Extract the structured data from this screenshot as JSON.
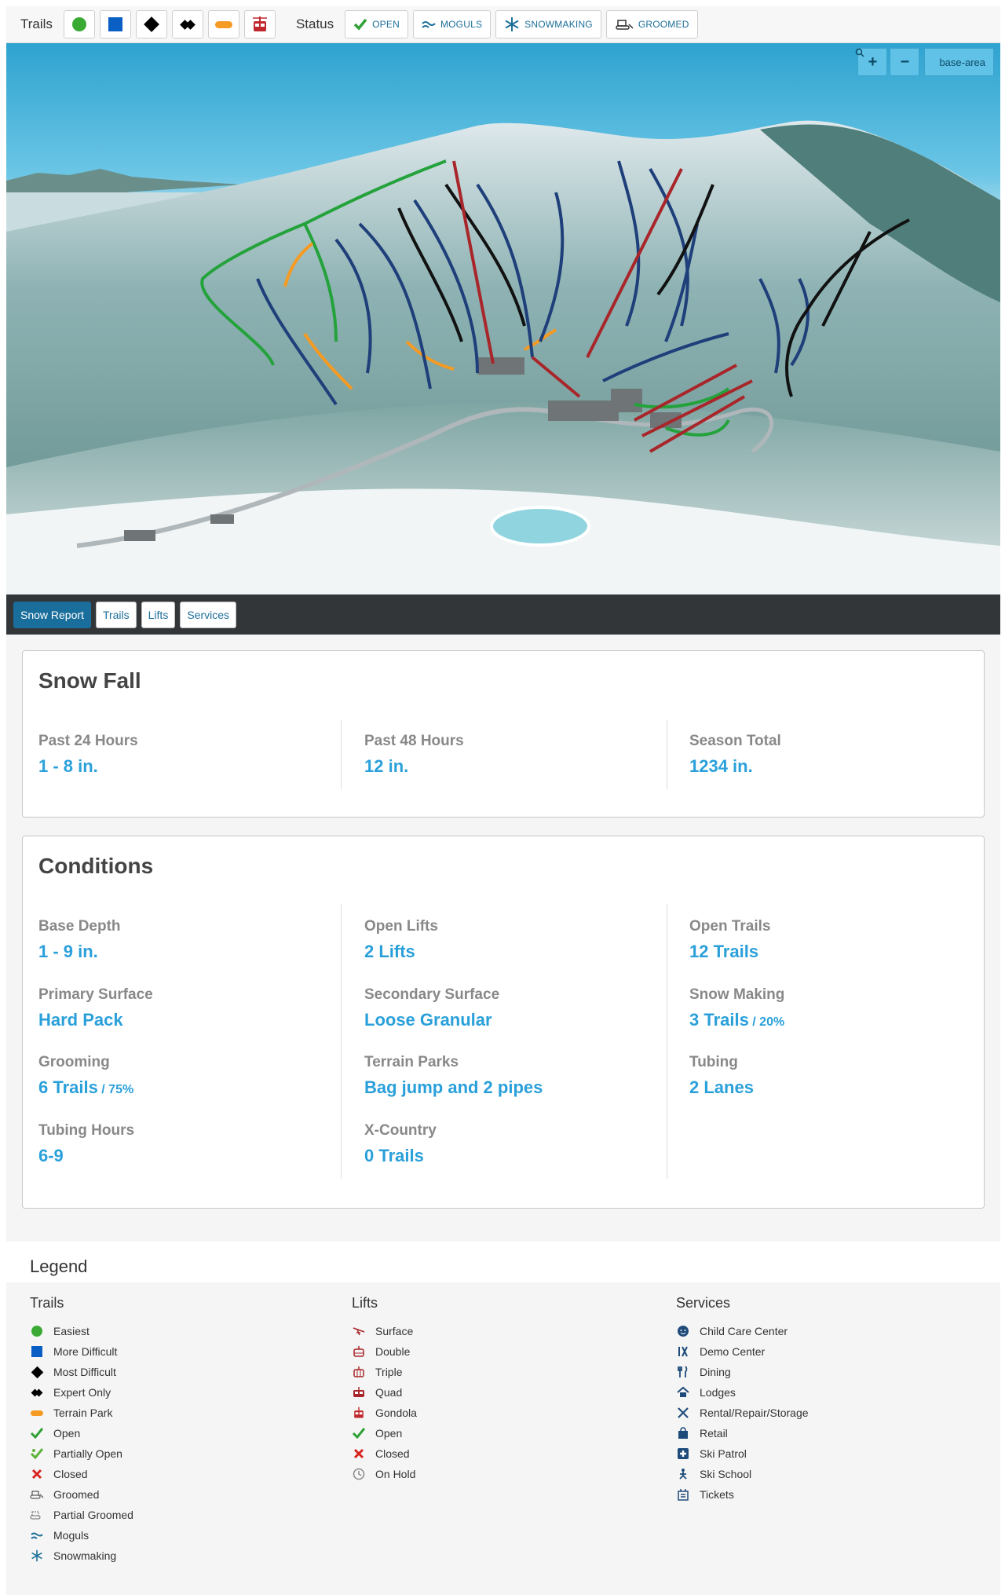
{
  "toolbar": {
    "trails_label": "Trails",
    "status_label": "Status",
    "trail_filters": [
      {
        "icon": "easiest-circle-icon",
        "color": "#3aaa35"
      },
      {
        "icon": "more-difficult-square-icon",
        "color": "#0a5fc4"
      },
      {
        "icon": "most-difficult-diamond-icon",
        "color": "#000000"
      },
      {
        "icon": "expert-double-diamond-icon",
        "color": "#000000"
      },
      {
        "icon": "terrain-park-icon",
        "color": "#f59a23"
      },
      {
        "icon": "gondola-icon",
        "color": "#c0282d"
      }
    ],
    "status_filters": {
      "open": "OPEN",
      "moguls": "MOGULS",
      "snowmaking": "SNOWMAKING",
      "groomed": "GROOMED"
    }
  },
  "map": {
    "zoom_in": "+",
    "zoom_out": "−",
    "base_area": "base-area"
  },
  "tabs": {
    "snow_report": "Snow Report",
    "trails": "Trails",
    "lifts": "Lifts",
    "services": "Services"
  },
  "snowfall": {
    "title": "Snow Fall",
    "past24_label": "Past 24 Hours",
    "past24_value": "1 - 8 in.",
    "past48_label": "Past 48 Hours",
    "past48_value": "12 in.",
    "season_label": "Season Total",
    "season_value": "1234 in."
  },
  "conditions": {
    "title": "Conditions",
    "base_depth_label": "Base Depth",
    "base_depth_value": "1 - 9 in.",
    "open_lifts_label": "Open Lifts",
    "open_lifts_value": "2 Lifts",
    "open_trails_label": "Open Trails",
    "open_trails_value": "12 Trails",
    "primary_surface_label": "Primary Surface",
    "primary_surface_value": "Hard Pack",
    "secondary_surface_label": "Secondary Surface",
    "secondary_surface_value": "Loose Granular",
    "snow_making_label": "Snow Making",
    "snow_making_value": "3 Trails",
    "snow_making_pct": " / 20%",
    "grooming_label": "Grooming",
    "grooming_value": "6 Trails",
    "grooming_pct": " / 75%",
    "terrain_parks_label": "Terrain Parks",
    "terrain_parks_value": "Bag jump and 2 pipes",
    "tubing_label": "Tubing",
    "tubing_value": "2 Lanes",
    "tubing_hours_label": "Tubing Hours",
    "tubing_hours_value": "6-9",
    "xcountry_label": "X-Country",
    "xcountry_value": "0 Trails"
  },
  "legend": {
    "title": "Legend",
    "trails_heading": "Trails",
    "trails": [
      "Easiest",
      "More Difficult",
      "Most Difficult",
      "Expert Only",
      "Terrain Park",
      "Open",
      "Partially Open",
      "Closed",
      "Groomed",
      "Partial Groomed",
      "Moguls",
      "Snowmaking"
    ],
    "lifts_heading": "Lifts",
    "lifts": [
      "Surface",
      "Double",
      "Triple",
      "Quad",
      "Gondola",
      "Open",
      "Closed",
      "On Hold"
    ],
    "services_heading": "Services",
    "services": [
      "Child Care Center",
      "Demo Center",
      "Dining",
      "Lodges",
      "Rental/Repair/Storage",
      "Retail",
      "Ski Patrol",
      "Ski School",
      "Tickets"
    ]
  },
  "colors": {
    "accent": "#2aa0da",
    "tab_active": "#1a6e9b",
    "easiest": "#3aaa35",
    "more_difficult": "#0a5fc4",
    "terrain_park": "#f59a23",
    "lift": "#a8262a",
    "closed": "#d9231f"
  }
}
